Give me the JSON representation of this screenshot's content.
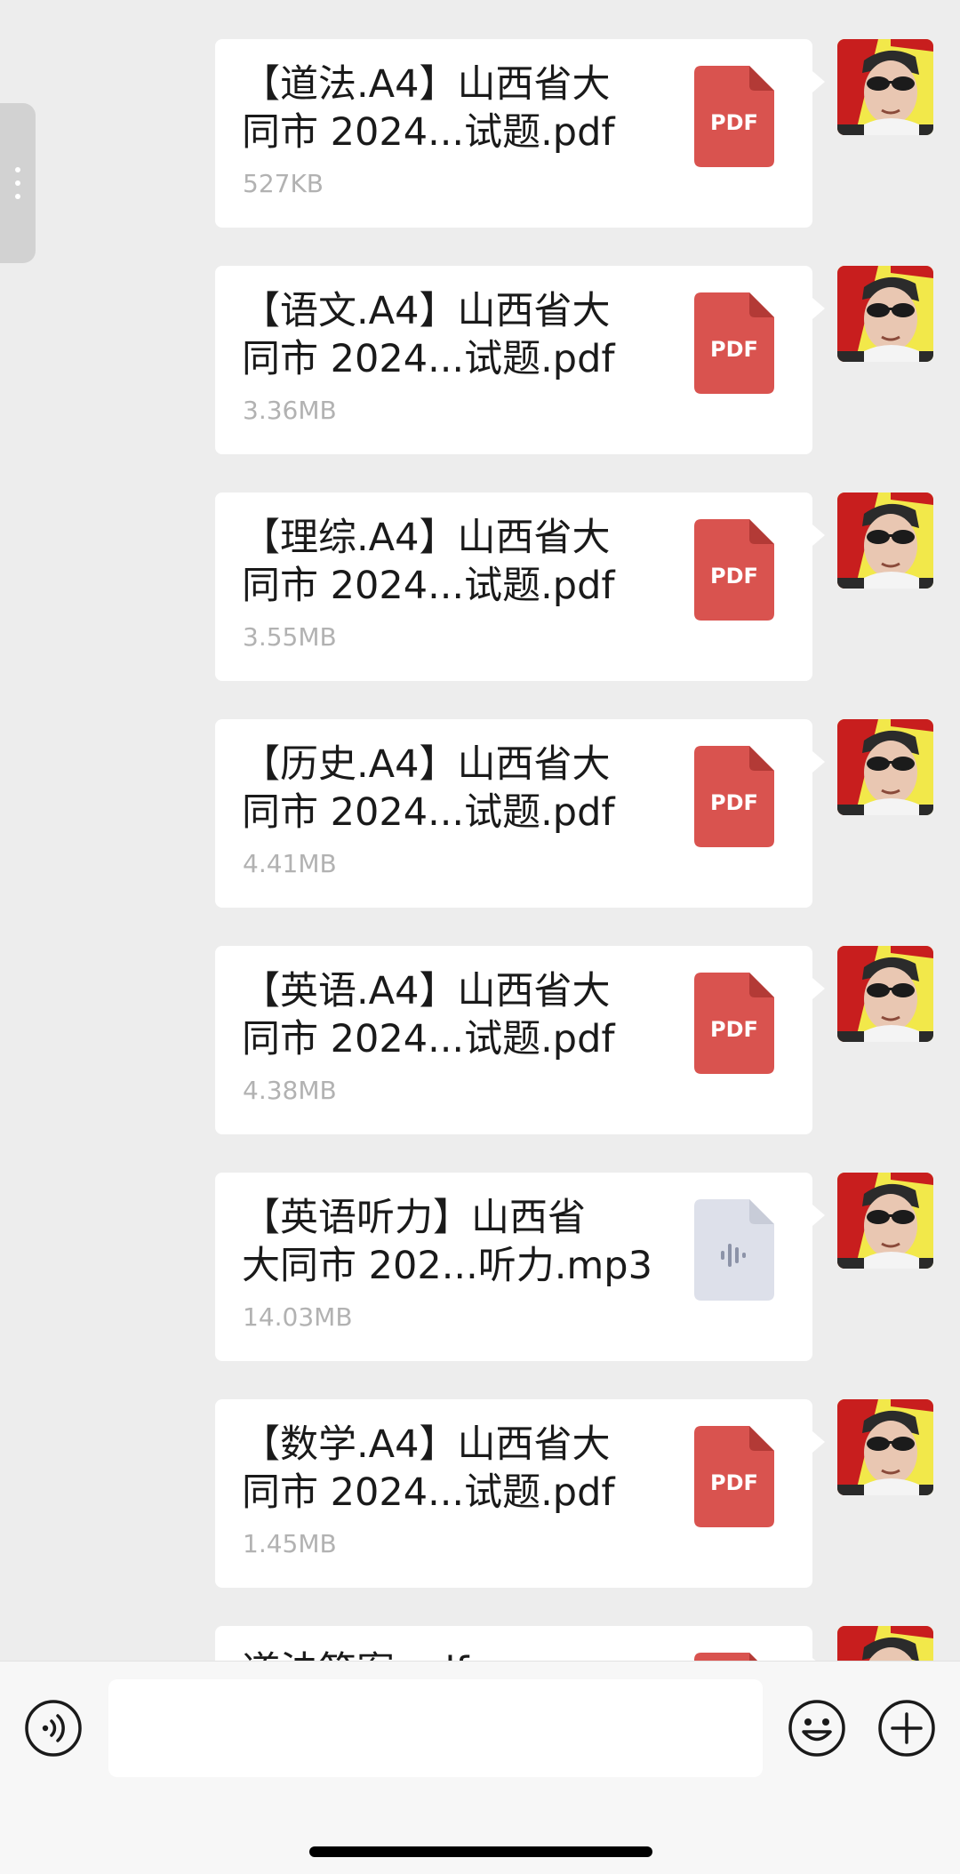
{
  "colors": {
    "background": "#ededed",
    "bubble": "#ffffff",
    "pdf_icon": "#d9534f",
    "audio_icon": "#dde0ea",
    "size_text": "#b2b2b2"
  },
  "messages": [
    {
      "name": "【道法.A4】山西省大\n同市 2024...试题.pdf",
      "size": "527KB",
      "type": "PDF",
      "icon": "pdf-file-icon"
    },
    {
      "name": "【语文.A4】山西省大\n同市 2024...试题.pdf",
      "size": "3.36MB",
      "type": "PDF",
      "icon": "pdf-file-icon"
    },
    {
      "name": "【理综.A4】山西省大\n同市 2024...试题.pdf",
      "size": "3.55MB",
      "type": "PDF",
      "icon": "pdf-file-icon"
    },
    {
      "name": "【历史.A4】山西省大\n同市 2024...试题.pdf",
      "size": "4.41MB",
      "type": "PDF",
      "icon": "pdf-file-icon"
    },
    {
      "name": "【英语.A4】山西省大\n同市 2024...试题.pdf",
      "size": "4.38MB",
      "type": "PDF",
      "icon": "pdf-file-icon"
    },
    {
      "name": "【英语听力】山西省\n大同市 202...听力.mp3",
      "size": "14.03MB",
      "type": "",
      "icon": "audio-file-icon"
    },
    {
      "name": "【数学.A4】山西省大\n同市 2024...试题.pdf",
      "size": "1.45MB",
      "type": "PDF",
      "icon": "pdf-file-icon"
    },
    {
      "name": "道法答案.pdf",
      "size": "",
      "type": "PDF",
      "icon": "pdf-file-icon"
    }
  ],
  "input_bar": {
    "voice_icon": "voice-icon",
    "emoji_icon": "emoji-icon",
    "plus_icon": "plus-icon",
    "placeholder": ""
  }
}
